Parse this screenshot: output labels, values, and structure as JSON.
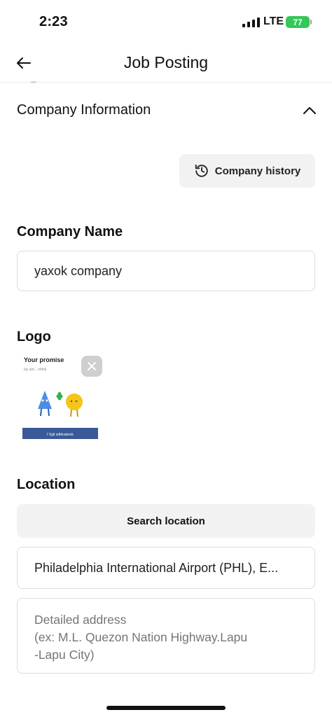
{
  "status_bar": {
    "time": "2:23",
    "network": "LTE",
    "battery": "77"
  },
  "nav": {
    "title": "Job Posting"
  },
  "company_section": {
    "title": "Company Information",
    "history_button": "Company history"
  },
  "company_name": {
    "label": "Company Name",
    "value": "yaxok company"
  },
  "logo": {
    "label": "Logo",
    "image_text": {
      "headline": "Your promise",
      "subtext": "lay ant... nbfsk",
      "footer": "f  Sgil  sdbfuaksnk"
    }
  },
  "location": {
    "label": "Location",
    "search_button": "Search location",
    "value": "Philadelphia International Airport (PHL), E...",
    "detail_placeholder": "Detailed address\n(ex: M.L. Quezon Nation Highway.Lapu\n-Lapu City)"
  },
  "colors": {
    "battery": "#34c759",
    "button_bg": "#f2f2f2",
    "border": "#dcdcdc",
    "placeholder": "#a6a6a6"
  }
}
